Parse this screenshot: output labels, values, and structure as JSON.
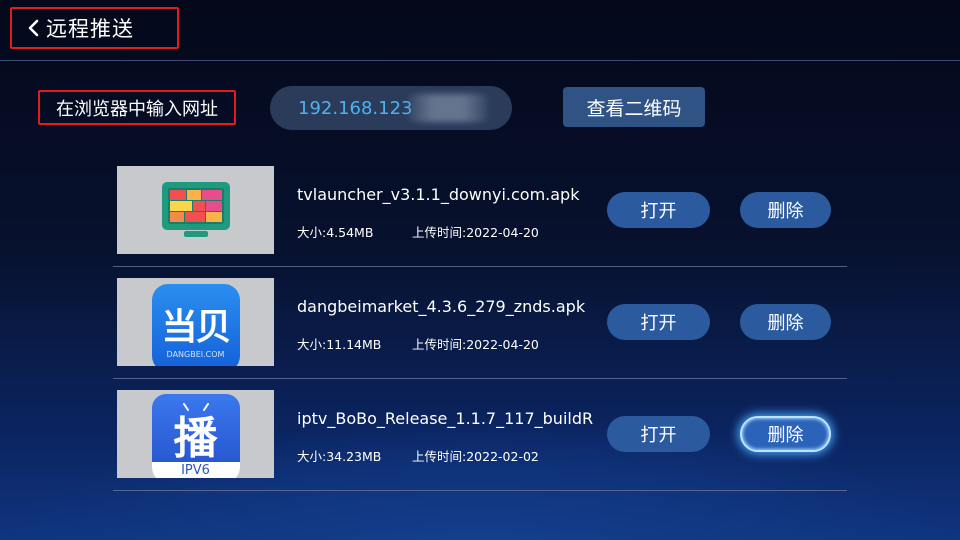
{
  "header": {
    "title": "远程推送",
    "back_icon": "chevron-left-icon"
  },
  "url_section": {
    "label": "在浏览器中输入网址",
    "ip_visible": "192.168.123",
    "qr_button": "查看二维码"
  },
  "files": [
    {
      "name": "tvlauncher_v3.1.1_downyi.com.apk",
      "size": "大小:4.54MB",
      "upload_time": "上传时间:2022-04-20",
      "icon": "tv-launcher-app-icon",
      "open_label": "打开",
      "delete_label": "删除"
    },
    {
      "name": "dangbeimarket_4.3.6_279_znds.apk",
      "size": "大小:11.14MB",
      "upload_time": "上传时间:2022-04-20",
      "icon": "dangbei-market-app-icon",
      "icon_text": "当贝",
      "icon_subtext": "DANGBEI.COM",
      "open_label": "打开",
      "delete_label": "删除"
    },
    {
      "name": "iptv_BoBo_Release_1.1.7_117_buildR",
      "size": "大小:34.23MB",
      "upload_time": "上传时间:2022-02-02",
      "icon": "bobo-iptv-app-icon",
      "icon_text": "播",
      "icon_subtext": "IPV6",
      "open_label": "打开",
      "delete_label": "删除",
      "delete_focused": true
    }
  ],
  "colors": {
    "highlight_border": "#e21b1b",
    "ip_text": "#4fb2ef",
    "button_bg": "#2b5a9f",
    "focus_glow": "#47a8ff"
  }
}
